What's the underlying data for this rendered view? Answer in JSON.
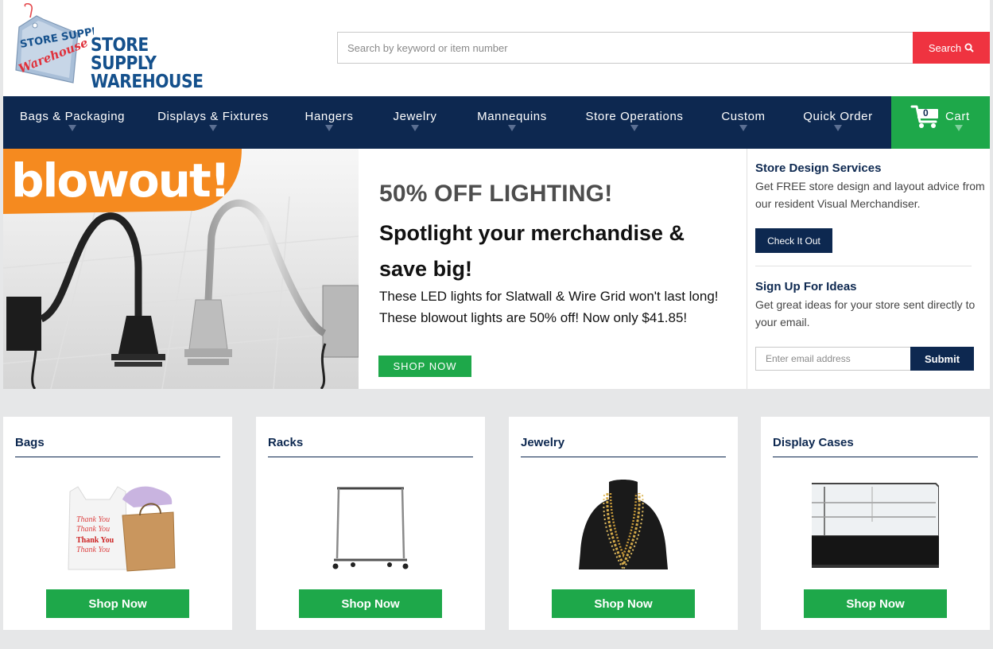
{
  "header": {
    "logo_text_line1": "STORE SUPPLY",
    "logo_text_line2": "WAREHOUSE",
    "tag_line1": "STORE SUPPLY",
    "tag_line2": "Warehouse",
    "search_placeholder": "Search by keyword or item number",
    "search_label": "Search",
    "search_icon": "search-icon"
  },
  "nav": {
    "items": [
      {
        "label": "Bags & Packaging"
      },
      {
        "label": "Displays & Fixtures"
      },
      {
        "label": "Hangers"
      },
      {
        "label": "Jewelry"
      },
      {
        "label": "Mannequins"
      },
      {
        "label": "Store Operations"
      },
      {
        "label": "Custom"
      },
      {
        "label": "Quick Order"
      }
    ],
    "cart_label": "Cart",
    "cart_count": "0",
    "cart_icon": "cart-icon"
  },
  "hero": {
    "badge": "blowout!",
    "headline": "50% OFF LIGHTING!",
    "subhead": "Spotlight your merchandise & save big!",
    "body_line1": "These LED lights for Slatwall & Wire Grid won't last long!",
    "body_line2": "These blowout lights are 50% off! Now only $41.85!",
    "cta": "SHOP NOW"
  },
  "sidebar": {
    "design_title": "Store Design Services",
    "design_text": "Get FREE store design and layout advice from our resident Visual Merchandiser.",
    "design_button": "Check It Out",
    "ideas_title": "Sign Up For Ideas",
    "ideas_text": "Get great ideas for your store sent directly to your email.",
    "email_placeholder": "Enter email address",
    "submit_label": "Submit"
  },
  "categories": [
    {
      "title": "Bags",
      "button": "Shop Now",
      "bag_text_1": "Thank You",
      "bag_text_2": "Thank You"
    },
    {
      "title": "Racks",
      "button": "Shop Now"
    },
    {
      "title": "Jewelry",
      "button": "Shop Now"
    },
    {
      "title": "Display Cases",
      "button": "Shop Now"
    }
  ],
  "colors": {
    "navy": "#0d2850",
    "green": "#1ea84a",
    "red": "#ef3340",
    "orange": "#f58a1f",
    "page_bg": "#e6e7e8"
  }
}
